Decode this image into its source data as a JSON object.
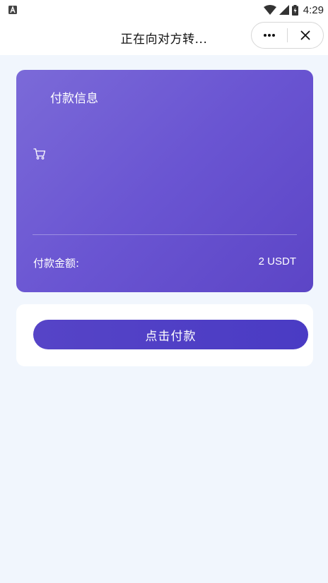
{
  "status_bar": {
    "time": "4:29",
    "icons": [
      "notification-a-icon",
      "wifi-icon",
      "signal-icon",
      "battery-charging-icon"
    ]
  },
  "header": {
    "title": "正在向对方转...",
    "menu_icon": "more-dots-icon",
    "close_icon": "close-icon"
  },
  "card": {
    "title": "付款信息",
    "icon": "cart-icon",
    "amount_label": "付款金额:",
    "amount_value": "2 USDT"
  },
  "action": {
    "pay_label": "点击付款"
  },
  "colors": {
    "background": "#f1f6fd",
    "card_start": "#7b6ad8",
    "card_end": "#5c45c6",
    "button": "#4f3fc5"
  }
}
